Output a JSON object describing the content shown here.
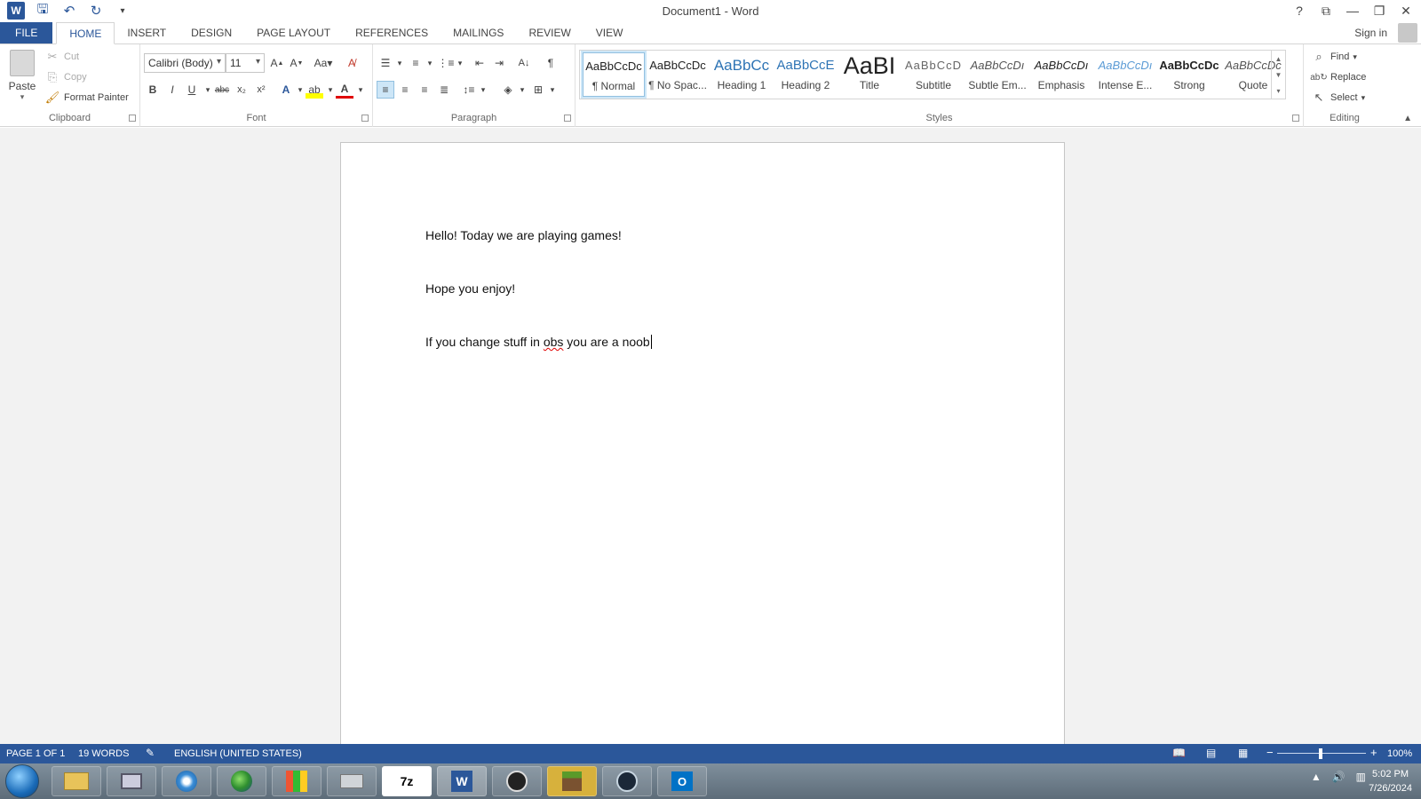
{
  "window": {
    "title": "Document1 - Word",
    "sign_in": "Sign in"
  },
  "tabs": [
    "FILE",
    "HOME",
    "INSERT",
    "DESIGN",
    "PAGE LAYOUT",
    "REFERENCES",
    "MAILINGS",
    "REVIEW",
    "VIEW"
  ],
  "clipboard": {
    "paste": "Paste",
    "cut": "Cut",
    "copy": "Copy",
    "format_painter": "Format Painter",
    "label": "Clipboard"
  },
  "font": {
    "family": "Calibri (Body)",
    "size": "11",
    "label": "Font"
  },
  "paragraph": {
    "label": "Paragraph"
  },
  "styles": {
    "label": "Styles",
    "items": [
      {
        "sample": "AaBbCcDc",
        "name": "¶ Normal"
      },
      {
        "sample": "AaBbCcDc",
        "name": "¶ No Spac..."
      },
      {
        "sample": "AaBbCc",
        "name": "Heading 1"
      },
      {
        "sample": "AaBbCcE",
        "name": "Heading 2"
      },
      {
        "sample": "AaBI",
        "name": "Title"
      },
      {
        "sample": "AaBbCcD",
        "name": "Subtitle"
      },
      {
        "sample": "AaBbCcDı",
        "name": "Subtle Em..."
      },
      {
        "sample": "AaBbCcDı",
        "name": "Emphasis"
      },
      {
        "sample": "AaBbCcDı",
        "name": "Intense E..."
      },
      {
        "sample": "AaBbCcDc",
        "name": "Strong"
      },
      {
        "sample": "AaBbCcDc",
        "name": "Quote"
      }
    ]
  },
  "editing": {
    "find": "Find",
    "replace": "Replace",
    "select": "Select",
    "label": "Editing"
  },
  "document": {
    "p1": "Hello! Today we are playing games!",
    "p2": "Hope you enjoy!",
    "p3_a": "If you change stuff in ",
    "p3_err": "obs",
    "p3_b": " you are a noob"
  },
  "status": {
    "page": "PAGE 1 OF 1",
    "words": "19 WORDS",
    "language": "ENGLISH (UNITED STATES)",
    "zoom": "100%"
  },
  "taskbar": {
    "time": "5:02 PM",
    "date": "7/26/2024",
    "apps": [
      "7z"
    ]
  },
  "colors": {
    "accent": "#2b579a",
    "spell_error": "#e00000"
  }
}
